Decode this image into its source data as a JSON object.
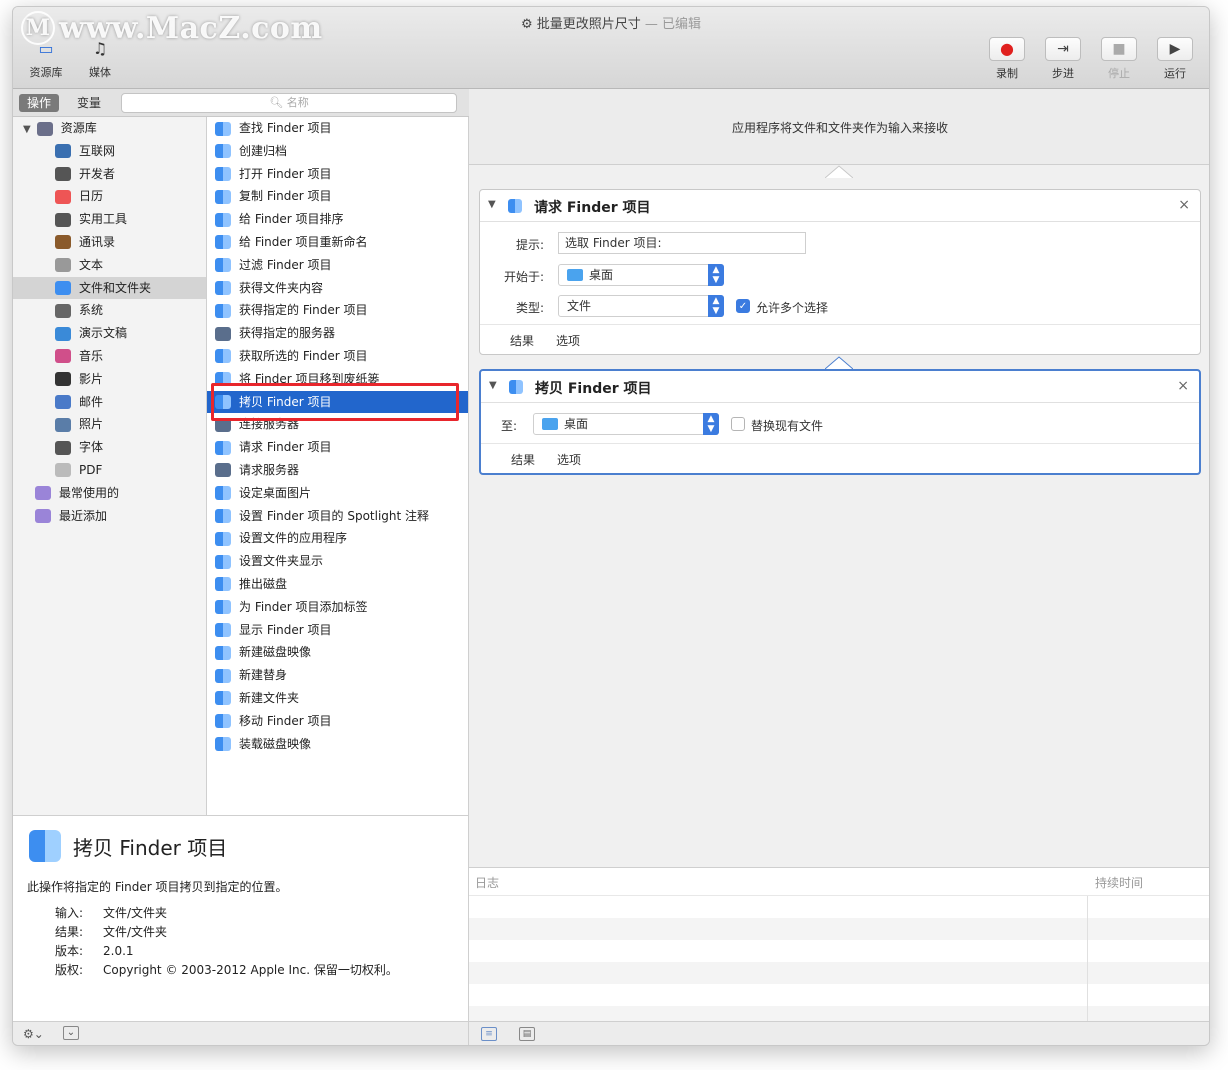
{
  "window": {
    "title": "批量更改照片尺寸",
    "edited": "— 已编辑",
    "watermark": "www.MacZ.com"
  },
  "toolbar": {
    "library": "资源库",
    "media": "媒体",
    "record": "录制",
    "step": "步进",
    "stop": "停止",
    "run": "运行"
  },
  "tabs": {
    "actions": "操作",
    "variables": "变量"
  },
  "search": {
    "placeholder": "名称"
  },
  "library": {
    "root": "资源库",
    "items": [
      "互联网",
      "开发者",
      "日历",
      "实用工具",
      "通讯录",
      "文本",
      "文件和文件夹",
      "系统",
      "演示文稿",
      "音乐",
      "影片",
      "邮件",
      "照片",
      "字体",
      "PDF"
    ],
    "selected_index": 6,
    "smart": [
      "最常使用的",
      "最近添加"
    ]
  },
  "actions_list": {
    "items": [
      "查找 Finder 项目",
      "创建归档",
      "打开 Finder 项目",
      "复制 Finder 项目",
      "给 Finder 项目排序",
      "给 Finder 项目重新命名",
      "过滤 Finder 项目",
      "获得文件夹内容",
      "获得指定的 Finder 项目",
      "获得指定的服务器",
      "获取所选的 Finder 项目",
      "将 Finder 项目移到废纸篓",
      "拷贝 Finder 项目",
      "连接服务器",
      "请求 Finder 项目",
      "请求服务器",
      "设定桌面图片",
      "设置 Finder 项目的 Spotlight 注释",
      "设置文件的应用程序",
      "设置文件夹显示",
      "推出磁盘",
      "为 Finder 项目添加标签",
      "显示 Finder 项目",
      "新建磁盘映像",
      "新建替身",
      "新建文件夹",
      "移动 Finder 项目",
      "装载磁盘映像"
    ],
    "selected_index": 12
  },
  "info": {
    "title": "拷贝 Finder 项目",
    "description": "此操作将指定的 Finder 项目拷贝到指定的位置。",
    "input_label": "输入:",
    "input_value": "文件/文件夹",
    "result_label": "结果:",
    "result_value": "文件/文件夹",
    "version_label": "版本:",
    "version_value": "2.0.1",
    "copyright_label": "版权:",
    "copyright_value": "Copyright © 2003-2012 Apple Inc. 保留一切权利。"
  },
  "workflow": {
    "input_text": "应用程序将文件和文件夹作为输入来接收",
    "action1": {
      "title": "请求 Finder 项目",
      "prompt_label": "提示:",
      "prompt_value": "选取 Finder 项目:",
      "start_label": "开始于:",
      "start_value": "桌面",
      "type_label": "类型:",
      "type_value": "文件",
      "allow_multi": "允许多个选择",
      "results": "结果",
      "options": "选项"
    },
    "action2": {
      "title": "拷贝 Finder 项目",
      "to_label": "至:",
      "to_value": "桌面",
      "replace": "替换现有文件",
      "results": "结果",
      "options": "选项"
    }
  },
  "log": {
    "log_label": "日志",
    "duration_label": "持续时间"
  }
}
